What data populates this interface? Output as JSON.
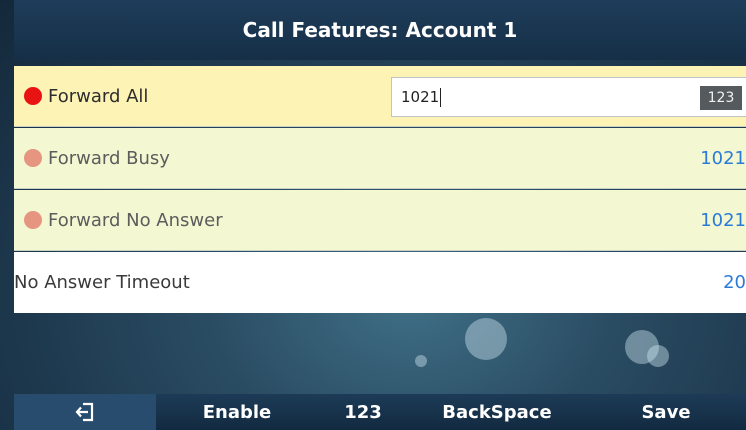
{
  "title": "Call Features: Account  1",
  "rows": [
    {
      "label": "Forward All",
      "input_value": "1021",
      "ime_mode": "123",
      "indicator": "active"
    },
    {
      "label": "Forward Busy",
      "value": "1021",
      "indicator": "muted"
    },
    {
      "label": "Forward No Answer",
      "value": "1021",
      "indicator": "muted"
    },
    {
      "label": "No Answer Timeout",
      "value": "20"
    }
  ],
  "softkeys": {
    "back_icon": "back-arrow-icon",
    "enable": "Enable",
    "ime": "123",
    "backspace": "BackSpace",
    "save": "Save"
  },
  "colors": {
    "active_dot": "#ea1313",
    "muted_dot": "#e59580",
    "value_text": "#2a7bd8",
    "selected_row": "#fcf3b5",
    "row_bg": "#f3f8d2"
  }
}
